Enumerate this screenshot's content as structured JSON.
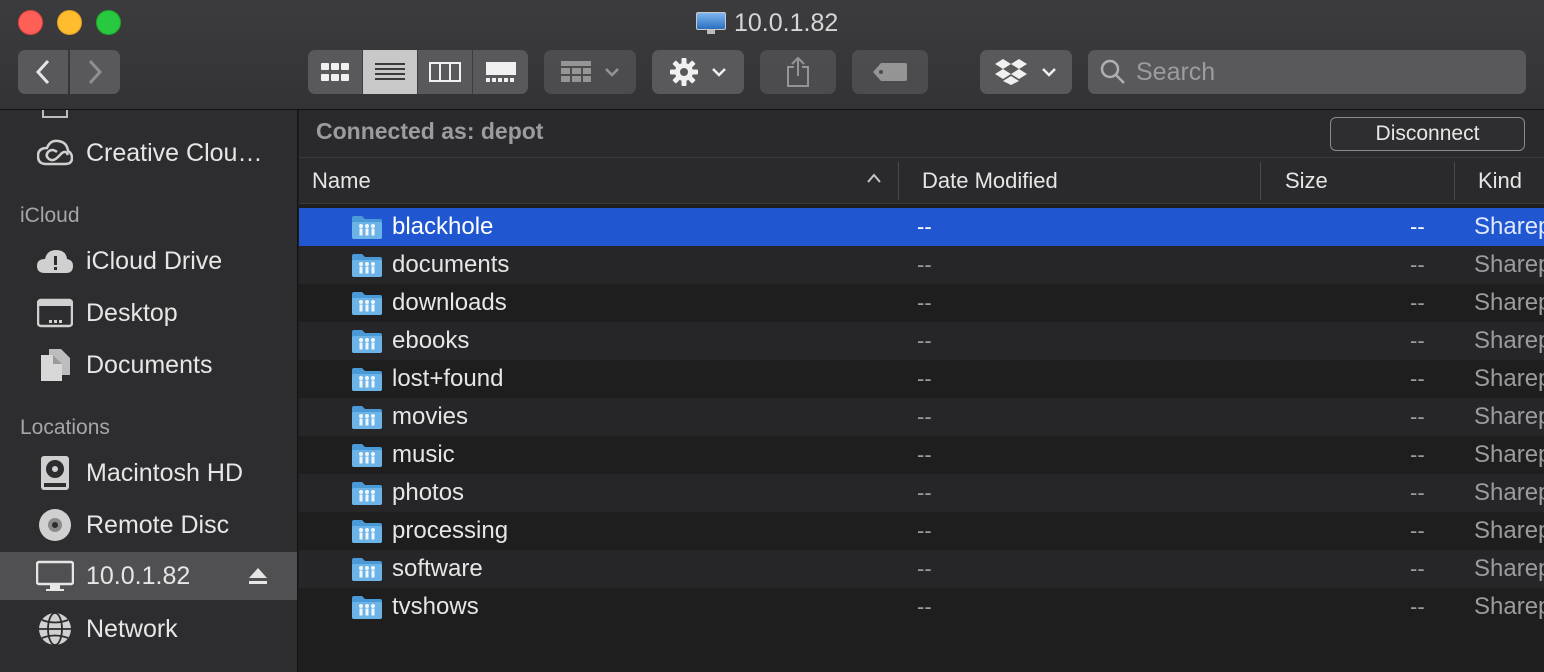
{
  "window": {
    "title": "10.0.1.82"
  },
  "toolbar": {
    "search_placeholder": "Search"
  },
  "sidebar": {
    "sections": [
      {
        "heading": "iCloud"
      },
      {
        "heading": "Locations"
      }
    ],
    "items": [
      {
        "label": "Creative Clou…",
        "icon": "creative-cloud-icon"
      },
      {
        "label": "iCloud Drive",
        "icon": "icloud-drive-icon"
      },
      {
        "label": "Desktop",
        "icon": "desktop-folder-icon"
      },
      {
        "label": "Documents",
        "icon": "documents-icon"
      },
      {
        "label": "Macintosh HD",
        "icon": "hard-drive-icon"
      },
      {
        "label": "Remote Disc",
        "icon": "remote-disc-icon"
      },
      {
        "label": "10.0.1.82",
        "icon": "monitor-icon",
        "selected": true
      },
      {
        "label": "Network",
        "icon": "network-globe-icon"
      }
    ]
  },
  "connection": {
    "status": "Connected as: depot",
    "disconnect_label": "Disconnect"
  },
  "table": {
    "columns": [
      "Name",
      "Date Modified",
      "Size",
      "Kind"
    ],
    "sort": {
      "column": "Name",
      "direction": "ascending"
    },
    "rows": [
      {
        "name": "blackhole",
        "date": "--",
        "size": "--",
        "kind": "Sharep",
        "selected": true
      },
      {
        "name": "documents",
        "date": "--",
        "size": "--",
        "kind": "Sharep"
      },
      {
        "name": "downloads",
        "date": "--",
        "size": "--",
        "kind": "Sharep"
      },
      {
        "name": "ebooks",
        "date": "--",
        "size": "--",
        "kind": "Sharep"
      },
      {
        "name": "lost+found",
        "date": "--",
        "size": "--",
        "kind": "Sharep"
      },
      {
        "name": "movies",
        "date": "--",
        "size": "--",
        "kind": "Sharep"
      },
      {
        "name": "music",
        "date": "--",
        "size": "--",
        "kind": "Sharep"
      },
      {
        "name": "photos",
        "date": "--",
        "size": "--",
        "kind": "Sharep"
      },
      {
        "name": "processing",
        "date": "--",
        "size": "--",
        "kind": "Sharep"
      },
      {
        "name": "software",
        "date": "--",
        "size": "--",
        "kind": "Sharep"
      },
      {
        "name": "tvshows",
        "date": "--",
        "size": "--",
        "kind": "Sharep"
      }
    ]
  },
  "colors": {
    "selection": "#2057d1",
    "sidebar_selected": "#505052",
    "folder_blue": "#6cb4e8"
  }
}
